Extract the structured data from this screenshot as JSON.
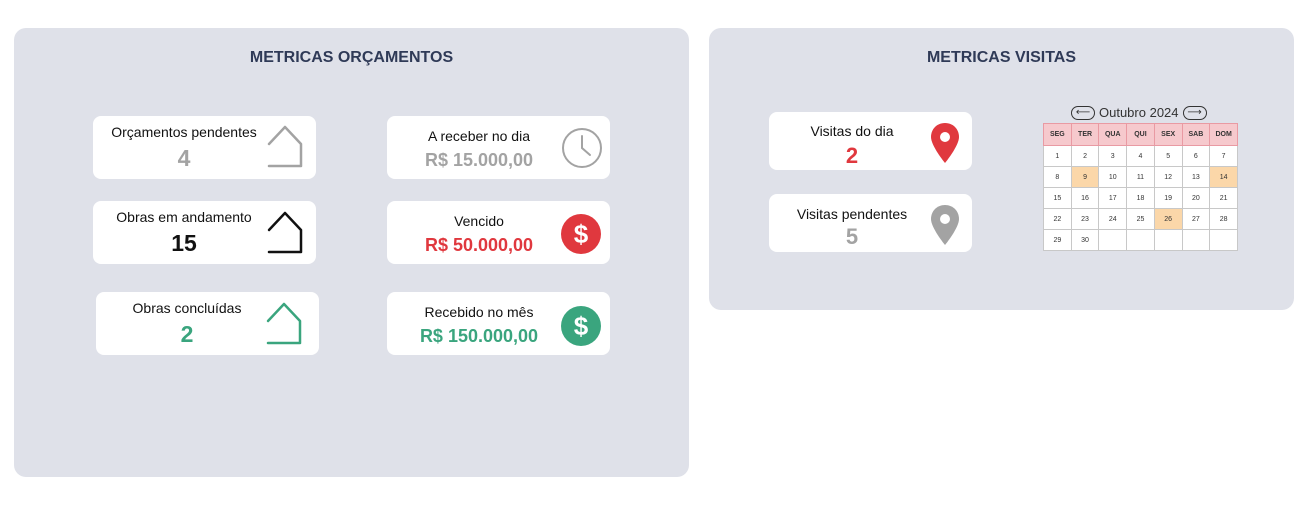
{
  "orcamentos": {
    "title": "METRICAS ORÇAMENTOS",
    "cards": {
      "pendentes": {
        "label": "Orçamentos pendentes",
        "value": "4"
      },
      "andamento": {
        "label": "Obras em andamento",
        "value": "15"
      },
      "concluidas": {
        "label": "Obras concluídas",
        "value": "2"
      },
      "receber": {
        "label": "A receber no dia",
        "value": "R$ 15.000,00"
      },
      "vencido": {
        "label": "Vencido",
        "value": "R$ 50.000,00"
      },
      "recebido": {
        "label": "Recebido no mês",
        "value": "R$ 150.000,00"
      }
    }
  },
  "visitas": {
    "title": "METRICAS VISITAS",
    "cards": {
      "dia": {
        "label": "Visitas do dia",
        "value": "2"
      },
      "pendentes": {
        "label": "Visitas pendentes",
        "value": "5"
      }
    },
    "calendar": {
      "month_label": "Outubro 2024",
      "prev_icon": "arrow-left-icon",
      "next_icon": "arrow-right-icon",
      "weekdays": [
        "SEG",
        "TER",
        "QUA",
        "QUI",
        "SEX",
        "SAB",
        "DOM"
      ],
      "weeks": [
        [
          "1",
          "2",
          "3",
          "4",
          "5",
          "6",
          "7"
        ],
        [
          "8",
          "9",
          "10",
          "11",
          "12",
          "13",
          "14"
        ],
        [
          "15",
          "16",
          "17",
          "18",
          "19",
          "20",
          "21"
        ],
        [
          "22",
          "23",
          "24",
          "25",
          "26",
          "27",
          "28"
        ],
        [
          "29",
          "30",
          "",
          "",
          "",
          "",
          ""
        ]
      ],
      "highlighted_days": [
        "9",
        "14",
        "26"
      ]
    }
  },
  "colors": {
    "panel_bg": "#dfe1e9",
    "title": "#2f3a57",
    "gray": "#a3a3a3",
    "red": "#e0383e",
    "green": "#3aa57e",
    "black": "#111111",
    "highlight": "#fbd7a9",
    "calendar_header": "#f6c9cd"
  }
}
